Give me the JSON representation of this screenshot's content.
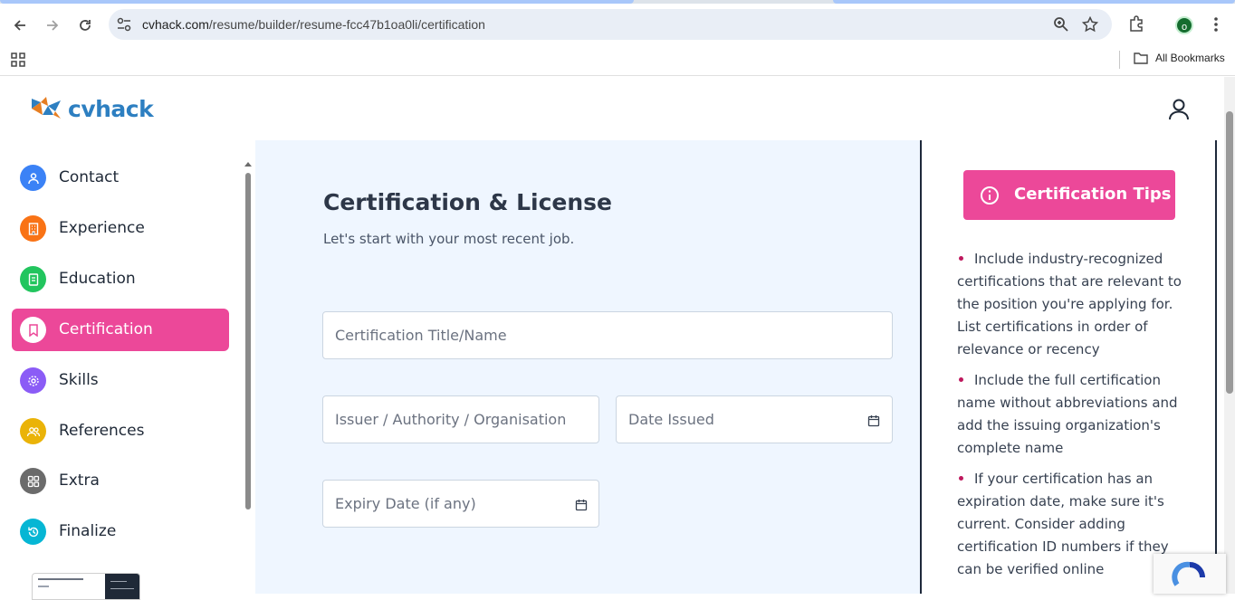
{
  "browser": {
    "url_domain": "cvhack.com",
    "url_path": "/resume/builder/resume-fcc47b1oa0li/certification",
    "profile_initial": "o",
    "bookmarks_label": "All Bookmarks"
  },
  "header": {
    "logo_text": "cvhack"
  },
  "sidebar": {
    "items": [
      {
        "label": "Contact",
        "color": "#3b82f6"
      },
      {
        "label": "Experience",
        "color": "#f97316"
      },
      {
        "label": "Education",
        "color": "#22c55e"
      },
      {
        "label": "Certification",
        "color": "#ec4899"
      },
      {
        "label": "Skills",
        "color": "#8b5cf6"
      },
      {
        "label": "References",
        "color": "#eab308"
      },
      {
        "label": "Extra",
        "color": "#6b6b6b"
      },
      {
        "label": "Finalize",
        "color": "#06b6d4"
      }
    ],
    "active_index": 3
  },
  "form": {
    "title": "Certification & License",
    "subtitle": "Let's start with your most recent job.",
    "title_placeholder": "Certification Title/Name",
    "issuer_placeholder": "Issuer / Authority / Organisation",
    "date_issued_placeholder": "Date Issued",
    "expiry_placeholder": "Expiry Date (if any)"
  },
  "tips": {
    "button_label": "Certification Tips",
    "items": [
      "Include industry-recognized certifications that are relevant to the position you're applying for. List certifications in order of relevance or recency",
      "Include the full certification name without abbreviations and add the issuing organization's complete name",
      "If your certification has an expiration date, make sure it's current. Consider adding certification ID numbers if they can be verified online"
    ]
  },
  "colors": {
    "accent": "#ec4899",
    "brand": "#2d7fc1",
    "form_bg": "#eff6ff"
  }
}
